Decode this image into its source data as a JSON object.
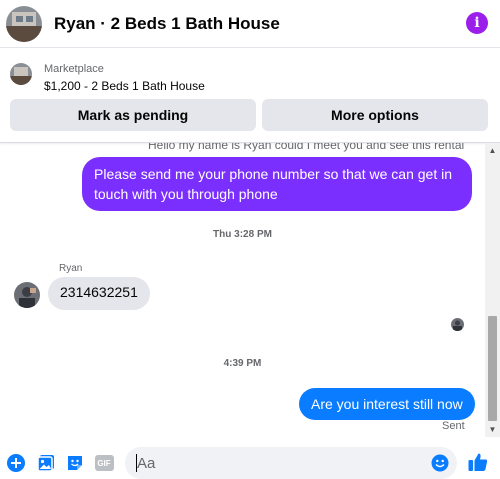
{
  "header": {
    "title": "Ryan · 2 Beds 1 Bath House",
    "info_icon": "info-icon",
    "accent": "#9b1eea"
  },
  "listing": {
    "source": "Marketplace",
    "price_title": "$1,200 - 2 Beds 1 Bath House",
    "mark_pending_label": "Mark as pending",
    "more_options_label": "More options"
  },
  "conversation": {
    "truncated_message": "Hello my name is Ryan could I meet you and see this rental",
    "outgoing_1": "Please send me your phone  number so that we can get in touch with you through phone",
    "timestamp_1": "Thu 3:28 PM",
    "sender_name": "Ryan",
    "incoming_1": "2314632251",
    "timestamp_2": "4:39 PM",
    "outgoing_2": "Are you interest still now",
    "status": "Sent",
    "colors": {
      "outgoing_purple": "#7b2fff",
      "outgoing_blue": "#0a7cff",
      "incoming": "#e4e6eb"
    }
  },
  "composer": {
    "placeholder": "Aa",
    "gif_label": "GIF",
    "icons": [
      "plus-icon",
      "photo-icon",
      "sticker-icon",
      "gif-icon",
      "emoji-icon",
      "thumbs-up-icon"
    ],
    "accent": "#0a7cff"
  }
}
